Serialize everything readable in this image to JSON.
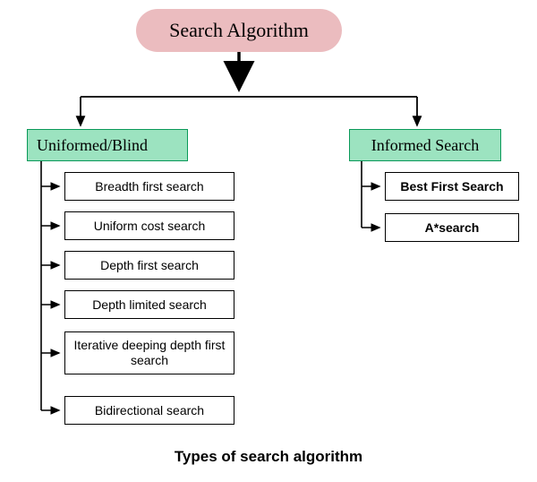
{
  "root": {
    "title": "Search Algorithm"
  },
  "branches": {
    "left": {
      "label": "Uniformed/Blind",
      "items": [
        "Breadth first search",
        "Uniform cost search",
        "Depth first search",
        "Depth limited search",
        "Iterative deeping depth first search",
        "Bidirectional search"
      ]
    },
    "right": {
      "label": "Informed Search",
      "items": [
        "Best First Search",
        "A*search"
      ]
    }
  },
  "caption": "Types of search algorithm"
}
